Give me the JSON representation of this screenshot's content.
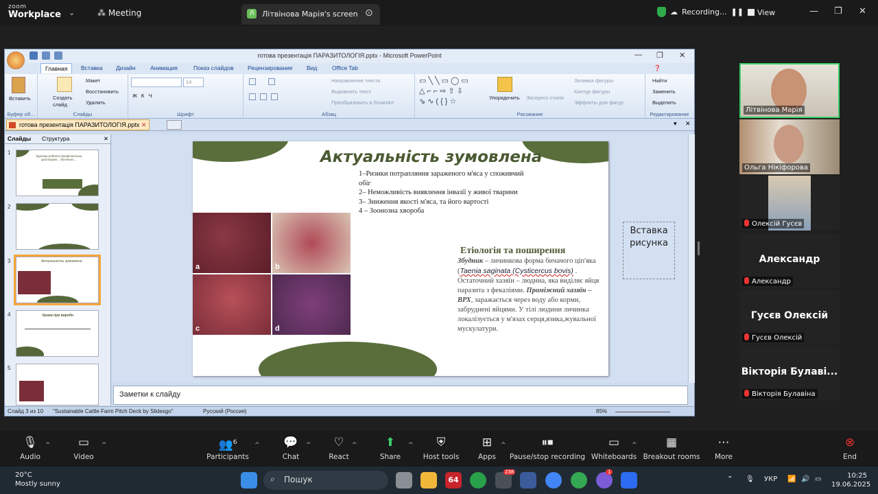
{
  "zoom": {
    "brand_top": "zoom",
    "brand": "Workplace",
    "meeting_label": "Meeting",
    "share_tab": "Літвінова Марія's screen",
    "recording_label": "Recording...",
    "view_label": "View"
  },
  "ppt": {
    "window_title": "готова презентація ПАРАЗИТОЛОГІЯ.pptx - Microsoft PowerPoint",
    "tabs": [
      "Главная",
      "Вставка",
      "Дизайн",
      "Анимация",
      "Показ слайдов",
      "Рецензирование",
      "Вид",
      "Office Tab"
    ],
    "ribbon": {
      "paste": "Вставить",
      "clipboard_group": "Буфер об...",
      "layout": "Макет",
      "reset": "Восстановить",
      "delete": "Удалить",
      "new_slide": "Создать слайд",
      "slides_group": "Слайды",
      "font_group": "Шрифт",
      "font_size": "14",
      "paragraph_group": "Абзац",
      "text_direction": "Направление текста",
      "align_text": "Выровнять текст",
      "smartart": "Преобразовать в SmartArt",
      "arrange": "Упорядочить",
      "quick_styles": "Экспресс-стили",
      "shape_fill": "Заливка фигуры",
      "shape_outline": "Контур фигуры",
      "shape_effects": "Эффекты для фигур",
      "drawing_group": "Рисование",
      "find": "Найти",
      "replace": "Заменить",
      "select": "Выделить",
      "editing_group": "Редактирование"
    },
    "doc_tab": "готова презентація ПАРАЗИТОЛОГІЯ.pptx",
    "pane_tabs": [
      "Слайды",
      "Структура"
    ],
    "thumb_numbers": [
      "1",
      "2",
      "3",
      "4",
      "5"
    ],
    "thumb1_title": "Курсова робота Профілактика цистицерк... бичачого ...",
    "thumb3_title": "Актуальність зумовлена",
    "thumb4_title": "Кроки при виробн",
    "slide": {
      "title": "Актуальність зумовлена",
      "list": [
        "1–Ризики потрапляння зараженого  м'яса у споживчий обіг",
        "2– Неможливість виявлення інвазії у живої тварини",
        "3– Зниження якості м'яса, та його вартості",
        "4 – Зоонозна хвороба"
      ],
      "subtitle": "Етіологія та поширення",
      "body_pathogen": "Збудник",
      "body_1": " – личинкова форма бичачого ціп'яка (",
      "body_species": "Taenia saginata (Cysticercus bovis)",
      "body_2": " . Остаточний хазяїн – людина, яка виділяє яйця паразита з фекаліями.",
      "body_host": "Проміжний хазяїн – ВРХ",
      "body_3": ", заражається через воду або корми, забруднені яйцями. У тілі людини личинка локалізується у м'язах серця,язика,жувальної мускулатури.",
      "photo_labels": [
        "a",
        "b",
        "c",
        "d"
      ]
    },
    "placeholder": "Вставка рисунка",
    "notes": "Заметки к слайду",
    "status": {
      "slide_of": "Слайд 3 из 10",
      "theme": "\"Sustainable Cattle Farm Pitch Deck by Slidesgo\"",
      "language": "Русский (Россия)",
      "zoom": "85%"
    }
  },
  "participants": [
    {
      "name": "Літвінова Марія",
      "video": true
    },
    {
      "name": "Ольга Нікіфорова",
      "video": true
    },
    {
      "name": "Олексій Гусєв",
      "video": true
    },
    {
      "name": "Александр",
      "big": "Александр"
    },
    {
      "name": "Гусєв Олексій",
      "big": "Гусєв Олексій"
    },
    {
      "name": "Вікторія Булавіна",
      "big": "Вікторія  Булаві..."
    }
  ],
  "toolbar": {
    "audio": "Audio",
    "video": "Video",
    "participants": "Participants",
    "participants_count": "6",
    "chat": "Chat",
    "react": "React",
    "share": "Share",
    "host_tools": "Host tools",
    "apps": "Apps",
    "pause_recording": "Pause/stop recording",
    "whiteboards": "Whiteboards",
    "breakout": "Breakout rooms",
    "more": "More",
    "end": "End"
  },
  "taskbar": {
    "temp": "20°C",
    "weather": "Mostly sunny",
    "search": "Пошук",
    "lang": "УКР",
    "time": "10:25",
    "date": "19.06.2025",
    "badge_64": "64",
    "badge_238": "238",
    "badge_1": "1"
  }
}
